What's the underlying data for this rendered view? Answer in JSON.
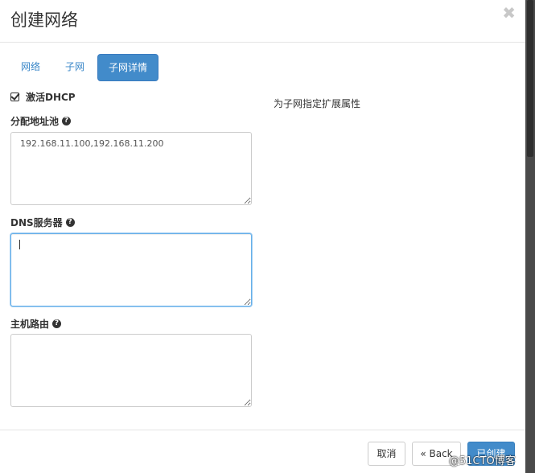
{
  "header": {
    "title": "创建网络",
    "close_glyph": "✖"
  },
  "tabs": [
    {
      "label": "网络",
      "active": false
    },
    {
      "label": "子网",
      "active": false
    },
    {
      "label": "子网详情",
      "active": true
    }
  ],
  "form": {
    "enable_dhcp": {
      "label": "激活DHCP",
      "checked": true
    },
    "allocation_pools": {
      "label": "分配地址池",
      "value": "192.168.11.100,192.168.11.200"
    },
    "dns_servers": {
      "label": "DNS服务器",
      "value": ""
    },
    "host_routes": {
      "label": "主机路由",
      "value": ""
    },
    "help_glyph": "?"
  },
  "help_text": "为子网指定扩展属性",
  "footer": {
    "cancel_label": "取消",
    "back_label": "« Back",
    "create_label": "已创建"
  },
  "watermark": "@51CTO博客",
  "colors": {
    "primary": "#428bca",
    "link": "#3a87c8",
    "focus_border": "#66afe9"
  }
}
